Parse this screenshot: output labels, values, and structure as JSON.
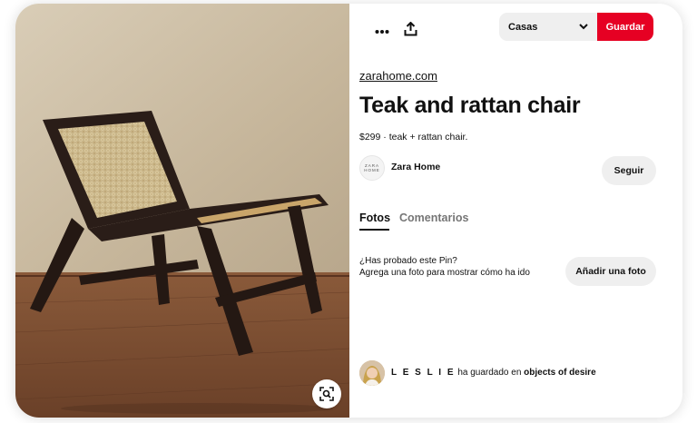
{
  "toolbar": {
    "more_icon": "more-horizontal-icon",
    "share_icon": "share-upload-icon",
    "board_value": "Casas",
    "save_label": "Guardar",
    "save_color": "#e60023"
  },
  "pin": {
    "source": "zarahome.com",
    "title": "Teak and rattan chair",
    "description": "$299 · teak + rattan chair.",
    "creator": {
      "name": "Zara Home",
      "avatar_text_1": "ZARA",
      "avatar_text_2": "HOME",
      "follow_label": "Seguir"
    }
  },
  "tabs": [
    {
      "label": "Fotos",
      "active": true
    },
    {
      "label": "Comentarios",
      "active": false
    }
  ],
  "tried": {
    "question": "¿Has probado este Pin?",
    "prompt": "Agrega una foto para mostrar cómo ha ido",
    "add_photo_label": "Añadir una foto"
  },
  "activity": {
    "user": "L E S L I E",
    "text": " ha guardado en ",
    "board": "objects of desire"
  },
  "image": {
    "lens_icon": "visual-search-icon",
    "alt": "Teak and rattan chair photo"
  }
}
